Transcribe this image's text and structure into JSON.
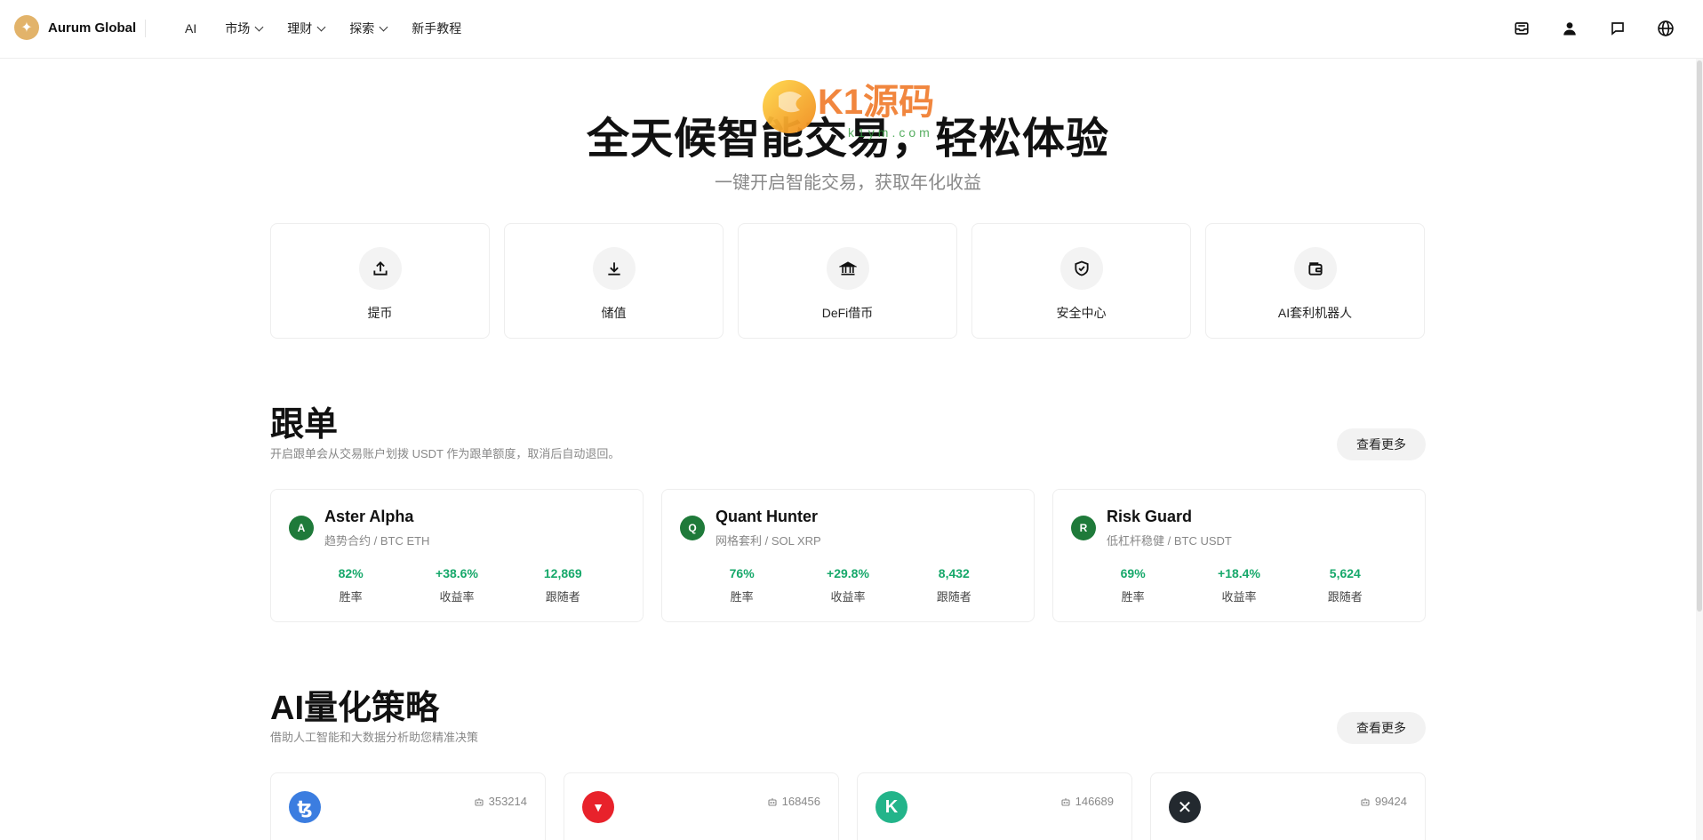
{
  "nav": {
    "brand": "Aurum Global",
    "menu": [
      {
        "label": "AI",
        "has_dropdown": false
      },
      {
        "label": "市场",
        "has_dropdown": true
      },
      {
        "label": "理财",
        "has_dropdown": true
      },
      {
        "label": "探索",
        "has_dropdown": true
      },
      {
        "label": "新手教程",
        "has_dropdown": false
      }
    ],
    "icons": [
      "inbox-icon",
      "user-icon",
      "chat-icon",
      "globe-icon"
    ]
  },
  "watermark": {
    "text": "K1源码",
    "sub": "k1ym.com"
  },
  "hero": {
    "title": "全天候智能交易，轻松体验",
    "subtitle": "一键开启智能交易，获取年化收益"
  },
  "quick_actions": [
    {
      "label": "提币",
      "icon": "upload-icon"
    },
    {
      "label": "储值",
      "icon": "download-icon"
    },
    {
      "label": "DeFi借币",
      "icon": "bank-icon"
    },
    {
      "label": "安全中心",
      "icon": "shield-check-icon"
    },
    {
      "label": "AI套利机器人",
      "icon": "wallet-icon"
    }
  ],
  "copy_trading": {
    "title": "跟单",
    "desc": "开启跟单会从交易账户划拨 USDT 作为跟单额度，取消后自动退回。",
    "more": "查看更多",
    "stat_labels": [
      "胜率",
      "收益率",
      "跟随者"
    ],
    "traders": [
      {
        "initial": "A",
        "name": "Aster Alpha",
        "sub": "趋势合约 / BTC ETH",
        "win_rate": "82%",
        "return": "+38.6%",
        "followers": "12,869"
      },
      {
        "initial": "Q",
        "name": "Quant Hunter",
        "sub": "网格套利 / SOL XRP",
        "win_rate": "76%",
        "return": "+29.8%",
        "followers": "8,432"
      },
      {
        "initial": "R",
        "name": "Risk Guard",
        "sub": "低杠杆稳健 / BTC USDT",
        "win_rate": "69%",
        "return": "+18.4%",
        "followers": "5,624"
      }
    ]
  },
  "ai_strategy": {
    "title": "AI量化策略",
    "desc": "借助人工智能和大数据分析助您精准决策",
    "more": "查看更多",
    "items": [
      {
        "logo": "tezos-icon",
        "symbol": "ꜩ",
        "color": "#3b7de0",
        "count": "353214"
      },
      {
        "logo": "tron-icon",
        "symbol": "▼",
        "color": "#e8222b",
        "count": "168456"
      },
      {
        "logo": "kucoin-icon",
        "symbol": "K",
        "color": "#23b48a",
        "count": "146689"
      },
      {
        "logo": "xrp-icon",
        "symbol": "✕",
        "color": "#23292f",
        "count": "99424"
      }
    ]
  },
  "colors": {
    "accent_gold": "#e2b36a",
    "positive": "#16a86a",
    "avatar_green": "#1f7a3a"
  }
}
